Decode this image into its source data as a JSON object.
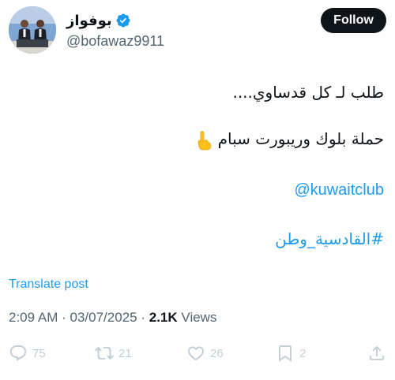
{
  "user": {
    "display_name": "بوفواز",
    "handle": "@bofawaz9911",
    "verified_icon": "verified-badge-icon",
    "avatar_icon": "profile-avatar"
  },
  "follow_button": {
    "label": "Follow"
  },
  "tweet": {
    "line1": "طلب لـ كل قدساوي....",
    "line2": "حملة بلوك وريبورت سبام",
    "line2_emoji": "backhand-index-pointing-down-icon",
    "mention": "@kuwaitclub",
    "hashtag": "#القادسية_وطن"
  },
  "translate": {
    "label": "Translate post"
  },
  "meta": {
    "time": "2:09 AM",
    "separator": "·",
    "date": "03/07/2025",
    "views_count": "2.1K",
    "views_label": "Views"
  },
  "actions": {
    "reply_count": "75",
    "retweet_count": "21",
    "like_count": "26",
    "bookmark_count": "2"
  },
  "colors": {
    "accent": "#1d9bf0",
    "text": "#0f1419",
    "muted": "#536471",
    "action_icon": "#c4cfd6"
  }
}
